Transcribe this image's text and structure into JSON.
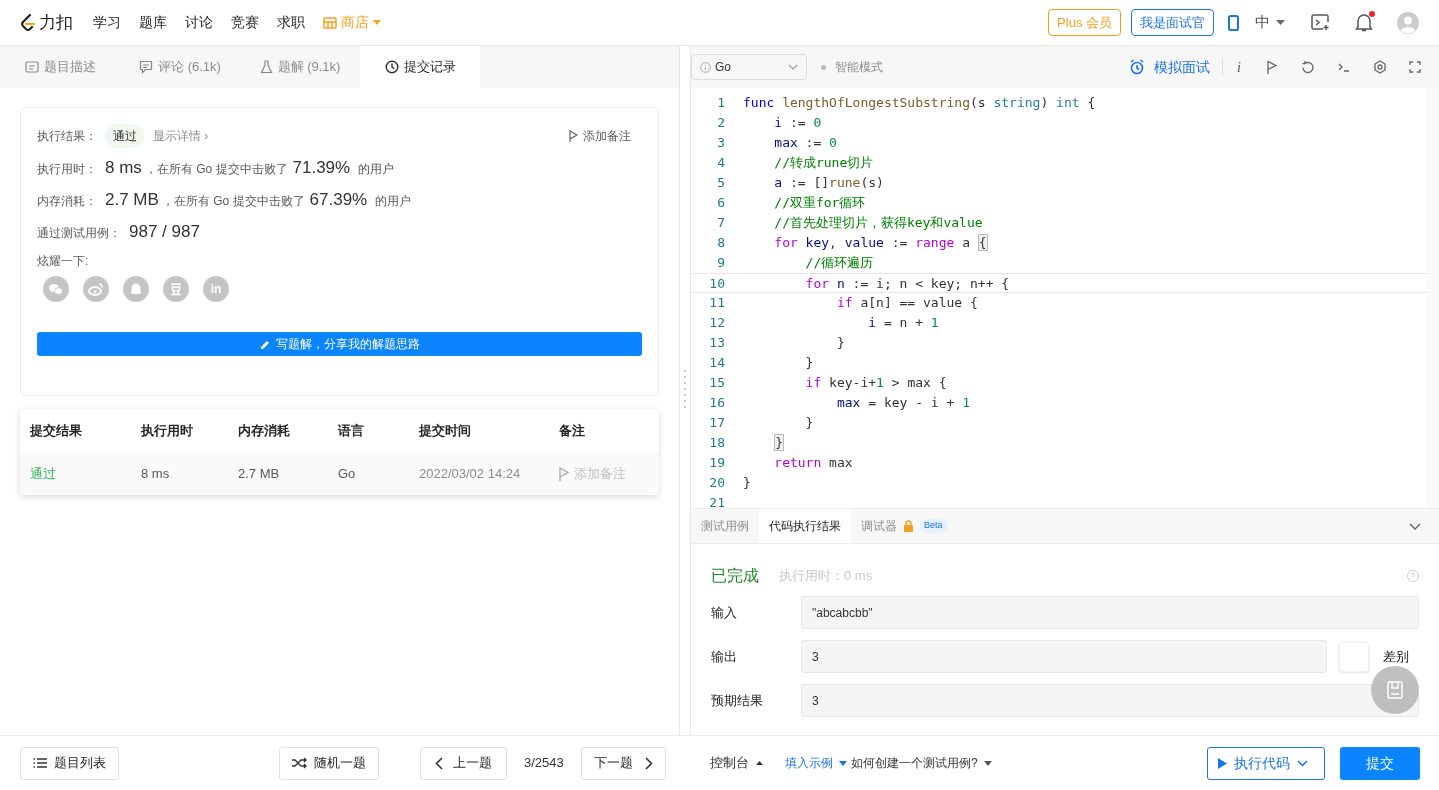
{
  "header": {
    "logo_text": "力扣",
    "nav": [
      {
        "label": "学习",
        "kind": "plain"
      },
      {
        "label": "题库",
        "kind": "plain"
      },
      {
        "label": "讨论",
        "kind": "plain"
      },
      {
        "label": "竞赛",
        "kind": "plain"
      },
      {
        "label": "求职",
        "kind": "plain"
      },
      {
        "label": "商店",
        "kind": "store"
      }
    ],
    "plus_button": "Plus 会员",
    "interviewer_button": "我是面试官",
    "language": "中",
    "notification_unread": true
  },
  "left_tabs": [
    {
      "label": "题目描述",
      "selected": false
    },
    {
      "label": "评论 (6.1k)",
      "selected": false
    },
    {
      "label": "题解 (9.1k)",
      "selected": false
    },
    {
      "label": "提交记录",
      "selected": true
    }
  ],
  "result": {
    "status_label": "执行结果：",
    "status": "通过",
    "details_link": "显示详情 ›",
    "add_note": "添加备注",
    "stats": [
      {
        "label": "执行用时：",
        "value": "8 ms",
        "mid": "，在所有 Go 提交中击败了",
        "percent": "71.39%",
        "suffix": "的用户"
      },
      {
        "label": "内存消耗：",
        "value": "2.7 MB",
        "mid": "，在所有 Go 提交中击败了",
        "percent": "67.39%",
        "suffix": "的用户"
      }
    ],
    "cases_label": "通过测试用例：",
    "cases": "987 / 987",
    "share_label": "炫耀一下:",
    "share_linkedin": "in",
    "write_button": "写题解，分享我的解题思路"
  },
  "submissions": {
    "columns": [
      "提交结果",
      "执行用时",
      "内存消耗",
      "语言",
      "提交时间",
      "备注"
    ],
    "rows": [
      {
        "status": "通过",
        "accepted": true,
        "time": "8 ms",
        "memory": "2.7 MB",
        "language": "Go",
        "submitted": "2022/03/02 14:24",
        "note": "添加备注"
      }
    ]
  },
  "editor_toolbar": {
    "language": "Go",
    "smart_mode": "智能模式",
    "mock_interview": "模拟面试",
    "info": "i"
  },
  "code": [
    {
      "n": "1",
      "current": false,
      "tokens": [
        {
          "t": "func ",
          "kind": "kw"
        },
        {
          "t": "lengthOfLongestSubstring",
          "kind": "fn"
        },
        {
          "t": "(s ",
          "kind": "p"
        },
        {
          "t": "string",
          "kind": "ty"
        },
        {
          "t": ") ",
          "kind": "p"
        },
        {
          "t": "int",
          "kind": "ty"
        },
        {
          "t": " {",
          "kind": "p"
        }
      ]
    },
    {
      "n": "2",
      "current": false,
      "tokens": [
        {
          "t": "    i",
          "kind": "var"
        },
        {
          "t": " := ",
          "kind": "p"
        },
        {
          "t": "0",
          "kind": "num"
        }
      ]
    },
    {
      "n": "3",
      "current": false,
      "tokens": [
        {
          "t": "    max",
          "kind": "var"
        },
        {
          "t": " := ",
          "kind": "p"
        },
        {
          "t": "0",
          "kind": "num"
        }
      ]
    },
    {
      "n": "4",
      "current": false,
      "tokens": [
        {
          "t": "    //转成rune切片",
          "kind": "cm"
        }
      ]
    },
    {
      "n": "5",
      "current": false,
      "tokens": [
        {
          "t": "    a",
          "kind": "var"
        },
        {
          "t": " := []",
          "kind": "p"
        },
        {
          "t": "rune",
          "kind": "fn"
        },
        {
          "t": "(s)",
          "kind": "p"
        }
      ]
    },
    {
      "n": "6",
      "current": false,
      "tokens": [
        {
          "t": "    //双重for循环",
          "kind": "cm"
        }
      ]
    },
    {
      "n": "7",
      "current": false,
      "tokens": [
        {
          "t": "    //首先处理切片，获得key和value",
          "kind": "cm"
        }
      ]
    },
    {
      "n": "8",
      "current": false,
      "tokens": [
        {
          "t": "    for",
          "kind": "ctrl"
        },
        {
          "t": " key",
          "kind": "var"
        },
        {
          "t": ", ",
          "kind": "p"
        },
        {
          "t": "value",
          "kind": "var"
        },
        {
          "t": " := ",
          "kind": "p"
        },
        {
          "t": "range",
          "kind": "ctrl"
        },
        {
          "t": " a ",
          "kind": "p"
        },
        {
          "t": "{",
          "kind": "match"
        }
      ]
    },
    {
      "n": "9",
      "current": false,
      "tokens": [
        {
          "t": "        //循环遍历",
          "kind": "cm"
        }
      ]
    },
    {
      "n": "10",
      "current": true,
      "tokens": [
        {
          "t": "        for",
          "kind": "ctrl"
        },
        {
          "t": " n",
          "kind": "var"
        },
        {
          "t": " := i; n < key; n++ {",
          "kind": "p"
        }
      ]
    },
    {
      "n": "11",
      "current": false,
      "tokens": [
        {
          "t": "            if",
          "kind": "ctrl"
        },
        {
          "t": " a[n] == value {",
          "kind": "p"
        }
      ]
    },
    {
      "n": "12",
      "current": false,
      "tokens": [
        {
          "t": "                i",
          "kind": "var"
        },
        {
          "t": " = n + ",
          "kind": "p"
        },
        {
          "t": "1",
          "kind": "num"
        }
      ]
    },
    {
      "n": "13",
      "current": false,
      "tokens": [
        {
          "t": "            }",
          "kind": "p"
        }
      ]
    },
    {
      "n": "14",
      "current": false,
      "tokens": [
        {
          "t": "        }",
          "kind": "p"
        }
      ]
    },
    {
      "n": "15",
      "current": false,
      "tokens": [
        {
          "t": "        if",
          "kind": "ctrl"
        },
        {
          "t": " key-i+",
          "kind": "p"
        },
        {
          "t": "1",
          "kind": "num"
        },
        {
          "t": " > max {",
          "kind": "p"
        }
      ]
    },
    {
      "n": "16",
      "current": false,
      "tokens": [
        {
          "t": "            max",
          "kind": "var"
        },
        {
          "t": " = key - i + ",
          "kind": "p"
        },
        {
          "t": "1",
          "kind": "num"
        }
      ]
    },
    {
      "n": "17",
      "current": false,
      "tokens": [
        {
          "t": "        }",
          "kind": "p"
        }
      ]
    },
    {
      "n": "18",
      "current": false,
      "tokens": [
        {
          "t": "    }",
          "kind": "match"
        }
      ]
    },
    {
      "n": "19",
      "current": false,
      "tokens": [
        {
          "t": "    return",
          "kind": "ctrl"
        },
        {
          "t": " max",
          "kind": "p"
        }
      ]
    },
    {
      "n": "20",
      "current": false,
      "tokens": [
        {
          "t": "}",
          "kind": "p"
        }
      ]
    },
    {
      "n": "21",
      "current": false
    }
  ],
  "console": {
    "tabs": [
      {
        "label": "测试用例",
        "selected": false,
        "locked": false
      },
      {
        "label": "代码执行结果",
        "selected": true,
        "locked": false
      },
      {
        "label": "调试器",
        "selected": false,
        "locked": true,
        "badge": "Beta"
      }
    ],
    "status": "已完成",
    "time": "执行用时：0 ms",
    "fields": [
      {
        "label": "输入",
        "value": "\"abcabcbb\"",
        "diff": false
      },
      {
        "label": "输出",
        "value": "3",
        "diff": true
      },
      {
        "label": "预期结果",
        "value": "3",
        "diff": false
      }
    ],
    "diff_label": "差别"
  },
  "footer": {
    "problem_list": "题目列表",
    "random": "随机一题",
    "prev": "上一题",
    "page": "3/2543",
    "next": "下一题",
    "console": "控制台",
    "fill_example": "填入示例",
    "howto": "如何创建一个测试用例?",
    "run": "执行代码",
    "submit": "提交"
  }
}
